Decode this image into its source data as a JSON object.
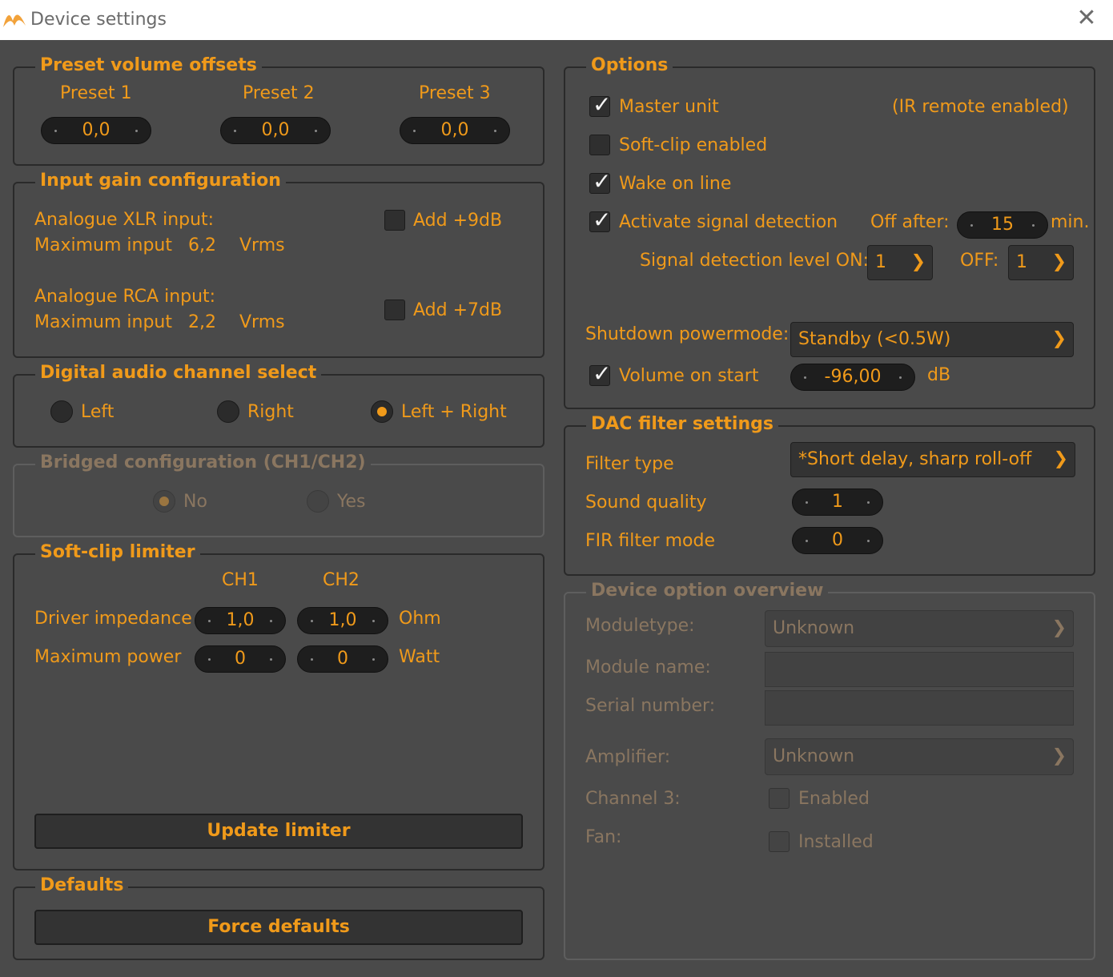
{
  "window": {
    "title": "Device settings"
  },
  "preset": {
    "legend": "Preset volume offsets",
    "items": [
      {
        "label": "Preset 1",
        "value": "0,0"
      },
      {
        "label": "Preset 2",
        "value": "0,0"
      },
      {
        "label": "Preset 3",
        "value": "0,0"
      }
    ]
  },
  "input_gain": {
    "legend": "Input gain configuration",
    "xlr_title": "Analogue XLR input:",
    "xlr_max_label": "Maximum input",
    "xlr_max_value": "6,2",
    "xlr_unit": "Vrms",
    "xlr_add": "Add +9dB",
    "rca_title": "Analogue RCA input:",
    "rca_max_label": "Maximum input",
    "rca_max_value": "2,2",
    "rca_unit": "Vrms",
    "rca_add": "Add +7dB"
  },
  "digital": {
    "legend": "Digital audio channel select",
    "options": [
      "Left",
      "Right",
      "Left + Right"
    ],
    "selected": "Left + Right"
  },
  "bridged": {
    "legend": "Bridged configuration (CH1/CH2)",
    "options": [
      "No",
      "Yes"
    ],
    "selected": "No"
  },
  "softclip": {
    "legend": "Soft-clip limiter",
    "ch1": "CH1",
    "ch2": "CH2",
    "impedance_label": "Driver impedance",
    "impedance_ch1": "1,0",
    "impedance_ch2": "1,0",
    "impedance_unit": "Ohm",
    "power_label": "Maximum power",
    "power_ch1": "0",
    "power_ch2": "0",
    "power_unit": "Watt",
    "update_button": "Update limiter"
  },
  "defaults": {
    "legend": "Defaults",
    "force_button": "Force defaults"
  },
  "options": {
    "legend": "Options",
    "master_unit": "Master unit",
    "ir_note": "(IR remote enabled)",
    "softclip_enabled": "Soft-clip enabled",
    "wake_on_line": "Wake on line",
    "activate_signal": "Activate signal detection",
    "off_after_label": "Off after:",
    "off_after_value": "15",
    "off_after_unit": "min.",
    "signal_on_label": "Signal detection level ON:",
    "signal_on_value": "1",
    "signal_off_label": "OFF:",
    "signal_off_value": "1",
    "shutdown_label": "Shutdown powermode:",
    "shutdown_value": "Standby (<0.5W)",
    "volume_start_label": "Volume on start",
    "volume_start_value": "-96,00",
    "volume_start_unit": "dB",
    "checked": {
      "master_unit": true,
      "softclip_enabled": false,
      "wake_on_line": true,
      "activate_signal": true,
      "volume_on_start": true
    }
  },
  "dac": {
    "legend": "DAC filter settings",
    "filter_type_label": "Filter type",
    "filter_type_value": "*Short delay, sharp roll-off",
    "sound_quality_label": "Sound quality",
    "sound_quality_value": "1",
    "fir_label": "FIR filter mode",
    "fir_value": "0"
  },
  "overview": {
    "legend": "Device option overview",
    "moduletype_label": "Moduletype:",
    "moduletype_value": "Unknown",
    "module_name_label": "Module name:",
    "module_name_value": "",
    "serial_label": "Serial number:",
    "serial_value": "",
    "amplifier_label": "Amplifier:",
    "amplifier_value": "Unknown",
    "channel3_label": "Channel 3:",
    "channel3_check": "Enabled",
    "fan_label": "Fan:",
    "fan_check": "Installed"
  },
  "colors": {
    "accent": "#f09a1a",
    "background": "#4a4a4a",
    "frame": "#2a2a2a",
    "disabled": "#8a7660"
  }
}
